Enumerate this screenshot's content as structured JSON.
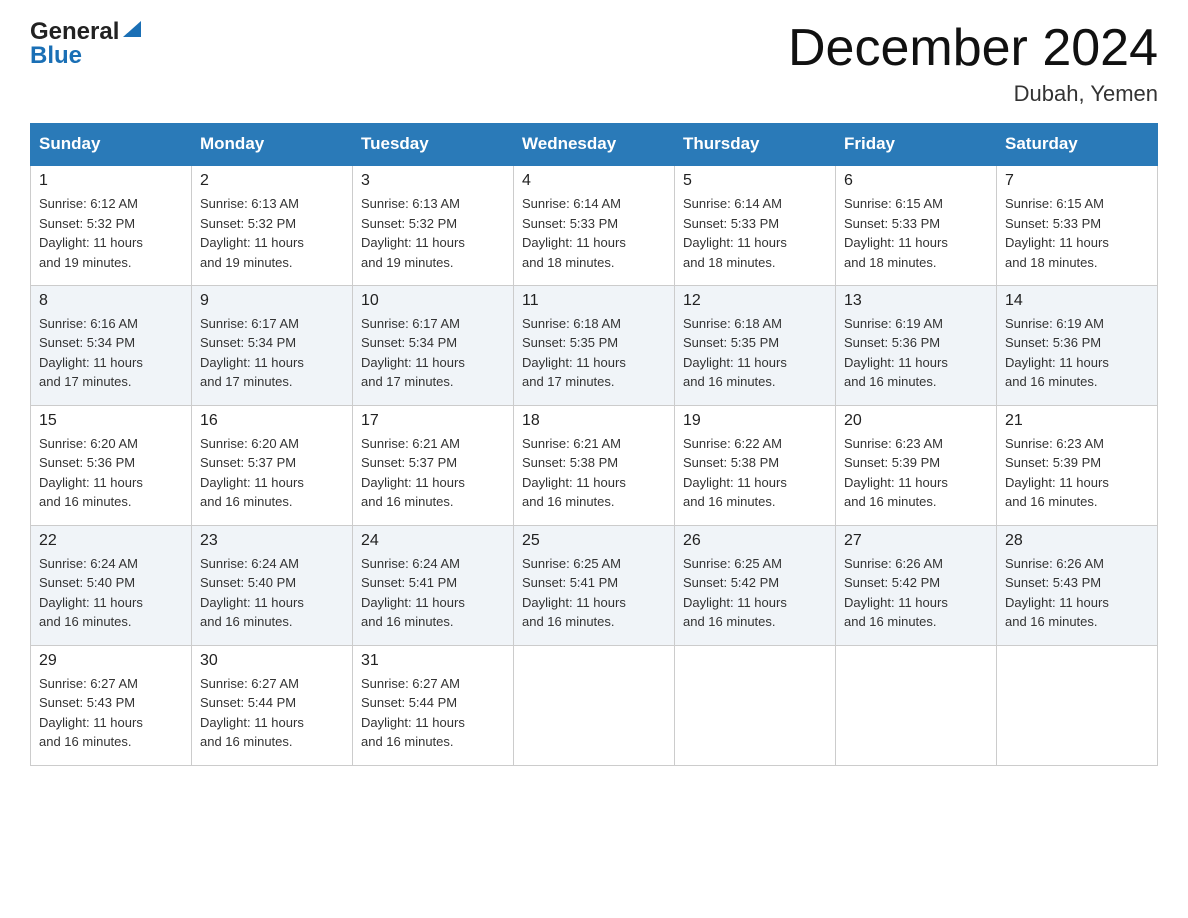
{
  "header": {
    "logo_general": "General",
    "logo_blue": "Blue",
    "month_title": "December 2024",
    "location": "Dubah, Yemen"
  },
  "days_of_week": [
    "Sunday",
    "Monday",
    "Tuesday",
    "Wednesday",
    "Thursday",
    "Friday",
    "Saturday"
  ],
  "weeks": [
    [
      {
        "day": "1",
        "sunrise": "6:12 AM",
        "sunset": "5:32 PM",
        "daylight": "11 hours and 19 minutes."
      },
      {
        "day": "2",
        "sunrise": "6:13 AM",
        "sunset": "5:32 PM",
        "daylight": "11 hours and 19 minutes."
      },
      {
        "day": "3",
        "sunrise": "6:13 AM",
        "sunset": "5:32 PM",
        "daylight": "11 hours and 19 minutes."
      },
      {
        "day": "4",
        "sunrise": "6:14 AM",
        "sunset": "5:33 PM",
        "daylight": "11 hours and 18 minutes."
      },
      {
        "day": "5",
        "sunrise": "6:14 AM",
        "sunset": "5:33 PM",
        "daylight": "11 hours and 18 minutes."
      },
      {
        "day": "6",
        "sunrise": "6:15 AM",
        "sunset": "5:33 PM",
        "daylight": "11 hours and 18 minutes."
      },
      {
        "day": "7",
        "sunrise": "6:15 AM",
        "sunset": "5:33 PM",
        "daylight": "11 hours and 18 minutes."
      }
    ],
    [
      {
        "day": "8",
        "sunrise": "6:16 AM",
        "sunset": "5:34 PM",
        "daylight": "11 hours and 17 minutes."
      },
      {
        "day": "9",
        "sunrise": "6:17 AM",
        "sunset": "5:34 PM",
        "daylight": "11 hours and 17 minutes."
      },
      {
        "day": "10",
        "sunrise": "6:17 AM",
        "sunset": "5:34 PM",
        "daylight": "11 hours and 17 minutes."
      },
      {
        "day": "11",
        "sunrise": "6:18 AM",
        "sunset": "5:35 PM",
        "daylight": "11 hours and 17 minutes."
      },
      {
        "day": "12",
        "sunrise": "6:18 AM",
        "sunset": "5:35 PM",
        "daylight": "11 hours and 16 minutes."
      },
      {
        "day": "13",
        "sunrise": "6:19 AM",
        "sunset": "5:36 PM",
        "daylight": "11 hours and 16 minutes."
      },
      {
        "day": "14",
        "sunrise": "6:19 AM",
        "sunset": "5:36 PM",
        "daylight": "11 hours and 16 minutes."
      }
    ],
    [
      {
        "day": "15",
        "sunrise": "6:20 AM",
        "sunset": "5:36 PM",
        "daylight": "11 hours and 16 minutes."
      },
      {
        "day": "16",
        "sunrise": "6:20 AM",
        "sunset": "5:37 PM",
        "daylight": "11 hours and 16 minutes."
      },
      {
        "day": "17",
        "sunrise": "6:21 AM",
        "sunset": "5:37 PM",
        "daylight": "11 hours and 16 minutes."
      },
      {
        "day": "18",
        "sunrise": "6:21 AM",
        "sunset": "5:38 PM",
        "daylight": "11 hours and 16 minutes."
      },
      {
        "day": "19",
        "sunrise": "6:22 AM",
        "sunset": "5:38 PM",
        "daylight": "11 hours and 16 minutes."
      },
      {
        "day": "20",
        "sunrise": "6:23 AM",
        "sunset": "5:39 PM",
        "daylight": "11 hours and 16 minutes."
      },
      {
        "day": "21",
        "sunrise": "6:23 AM",
        "sunset": "5:39 PM",
        "daylight": "11 hours and 16 minutes."
      }
    ],
    [
      {
        "day": "22",
        "sunrise": "6:24 AM",
        "sunset": "5:40 PM",
        "daylight": "11 hours and 16 minutes."
      },
      {
        "day": "23",
        "sunrise": "6:24 AM",
        "sunset": "5:40 PM",
        "daylight": "11 hours and 16 minutes."
      },
      {
        "day": "24",
        "sunrise": "6:24 AM",
        "sunset": "5:41 PM",
        "daylight": "11 hours and 16 minutes."
      },
      {
        "day": "25",
        "sunrise": "6:25 AM",
        "sunset": "5:41 PM",
        "daylight": "11 hours and 16 minutes."
      },
      {
        "day": "26",
        "sunrise": "6:25 AM",
        "sunset": "5:42 PM",
        "daylight": "11 hours and 16 minutes."
      },
      {
        "day": "27",
        "sunrise": "6:26 AM",
        "sunset": "5:42 PM",
        "daylight": "11 hours and 16 minutes."
      },
      {
        "day": "28",
        "sunrise": "6:26 AM",
        "sunset": "5:43 PM",
        "daylight": "11 hours and 16 minutes."
      }
    ],
    [
      {
        "day": "29",
        "sunrise": "6:27 AM",
        "sunset": "5:43 PM",
        "daylight": "11 hours and 16 minutes."
      },
      {
        "day": "30",
        "sunrise": "6:27 AM",
        "sunset": "5:44 PM",
        "daylight": "11 hours and 16 minutes."
      },
      {
        "day": "31",
        "sunrise": "6:27 AM",
        "sunset": "5:44 PM",
        "daylight": "11 hours and 16 minutes."
      },
      null,
      null,
      null,
      null
    ]
  ],
  "labels": {
    "sunrise_prefix": "Sunrise: ",
    "sunset_prefix": "Sunset: ",
    "daylight_prefix": "Daylight: "
  }
}
